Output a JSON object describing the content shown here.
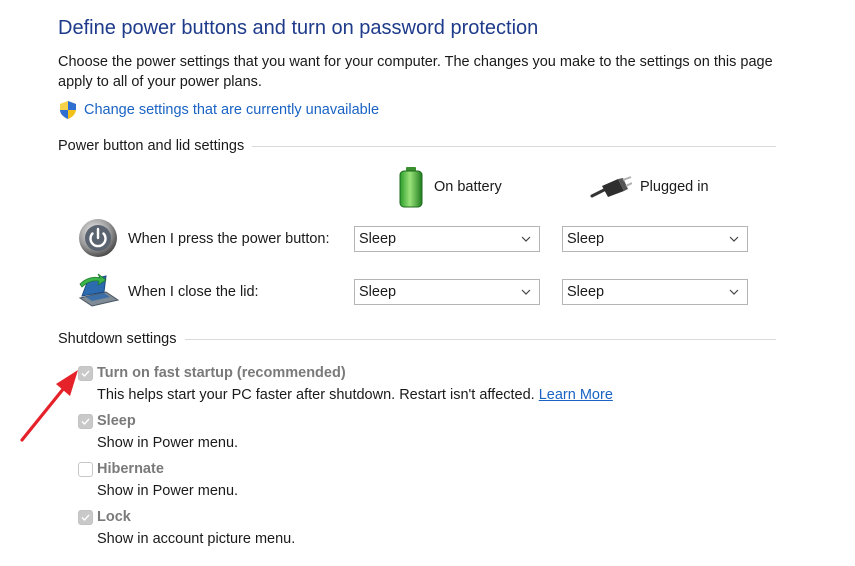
{
  "page": {
    "title": "Define power buttons and turn on password protection",
    "description": "Choose the power settings that you want for your computer. The changes you make to the settings on this page apply to all of your power plans.",
    "change_settings_link": "Change settings that are currently unavailable"
  },
  "power_section": {
    "heading": "Power button and lid settings",
    "columns": {
      "battery": "On battery",
      "plugged": "Plugged in"
    },
    "rows": [
      {
        "label": "When I press the power button:",
        "battery_value": "Sleep",
        "plugged_value": "Sleep"
      },
      {
        "label": "When I close the lid:",
        "battery_value": "Sleep",
        "plugged_value": "Sleep"
      }
    ]
  },
  "shutdown_section": {
    "heading": "Shutdown settings",
    "options": [
      {
        "name": "Turn on fast startup (recommended)",
        "checked": true,
        "description": "This helps start your PC faster after shutdown. Restart isn't affected.",
        "link": "Learn More"
      },
      {
        "name": "Sleep",
        "checked": true,
        "description": "Show in Power menu."
      },
      {
        "name": "Hibernate",
        "checked": false,
        "description": "Show in Power menu."
      },
      {
        "name": "Lock",
        "checked": true,
        "description": "Show in account picture menu."
      }
    ]
  },
  "colors": {
    "title": "#1e3a8a",
    "link": "#1a63c4",
    "annotation_arrow": "#e5222a",
    "disabled_text": "#7a7a7a"
  }
}
